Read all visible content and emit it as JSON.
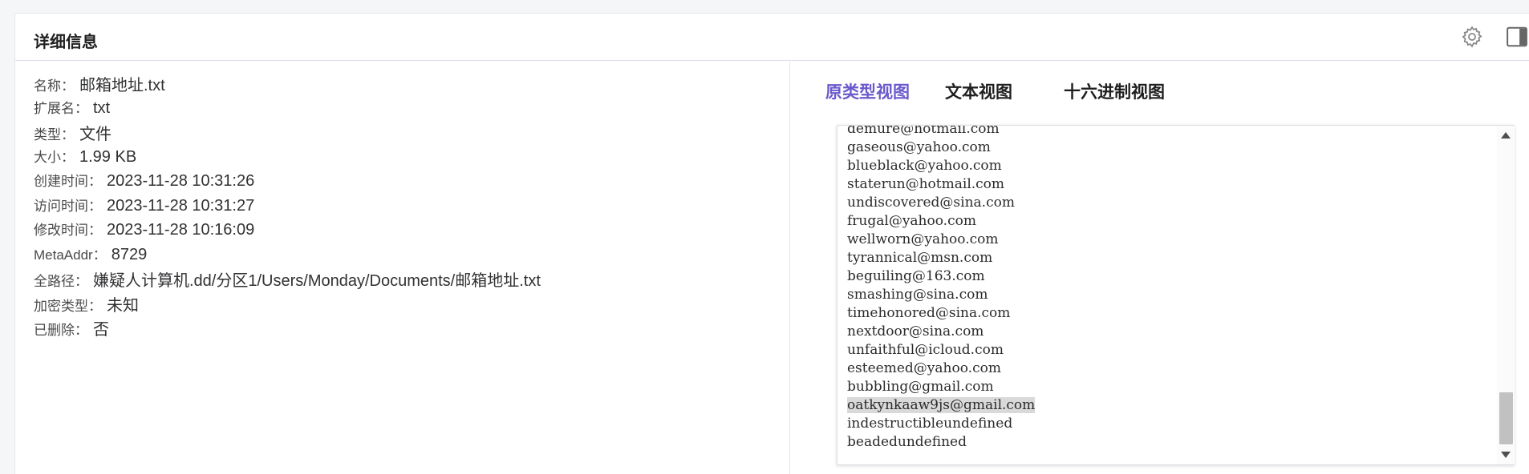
{
  "panel": {
    "title": "详细信息",
    "gear_icon": "gear-icon",
    "sidebar_icon": "sidebar-toggle-icon"
  },
  "info": [
    {
      "label": "名称：",
      "value": "邮箱地址.txt"
    },
    {
      "label": "扩展名：",
      "value": "txt"
    },
    {
      "label": "类型：",
      "value": "文件"
    },
    {
      "label": "大小：",
      "value": "1.99 KB"
    },
    {
      "label": "创建时间：",
      "value": "2023-11-28 10:31:26"
    },
    {
      "label": "访问时间：",
      "value": "2023-11-28 10:31:27"
    },
    {
      "label": "修改时间：",
      "value": "2023-11-28 10:16:09"
    },
    {
      "label": "MetaAddr：",
      "value": "8729"
    },
    {
      "label": "全路径：",
      "value": "嫌疑人计算机.dd/分区1/Users/Monday/Documents/邮箱地址.txt"
    },
    {
      "label": "加密类型：",
      "value": "未知"
    },
    {
      "label": "已删除：",
      "value": "否"
    }
  ],
  "tabs": [
    {
      "label": "原类型视图",
      "active": true
    },
    {
      "label": "文本视图",
      "active": false
    },
    {
      "label": "十六进制视图",
      "active": false
    }
  ],
  "viewer": {
    "lines": [
      "demure@hotmail.com",
      "gaseous@yahoo.com",
      "blueblack@yahoo.com",
      "staterun@hotmail.com",
      "undiscovered@sina.com",
      "frugal@yahoo.com",
      "wellworn@yahoo.com",
      "tyrannical@msn.com",
      "beguiling@163.com",
      "smashing@sina.com",
      "timehonored@sina.com",
      "nextdoor@sina.com",
      "unfaithful@icloud.com",
      "esteemed@yahoo.com",
      "bubbling@gmail.com",
      "oatkynkaaw9js@gmail.com",
      "indestructibleundefined",
      "beadedundefined"
    ],
    "highlighted_line": "oatkynkaaw9js@gmail.com"
  },
  "colors": {
    "active_tab": "#6a5acd",
    "highlight": "#d9d9d9"
  }
}
